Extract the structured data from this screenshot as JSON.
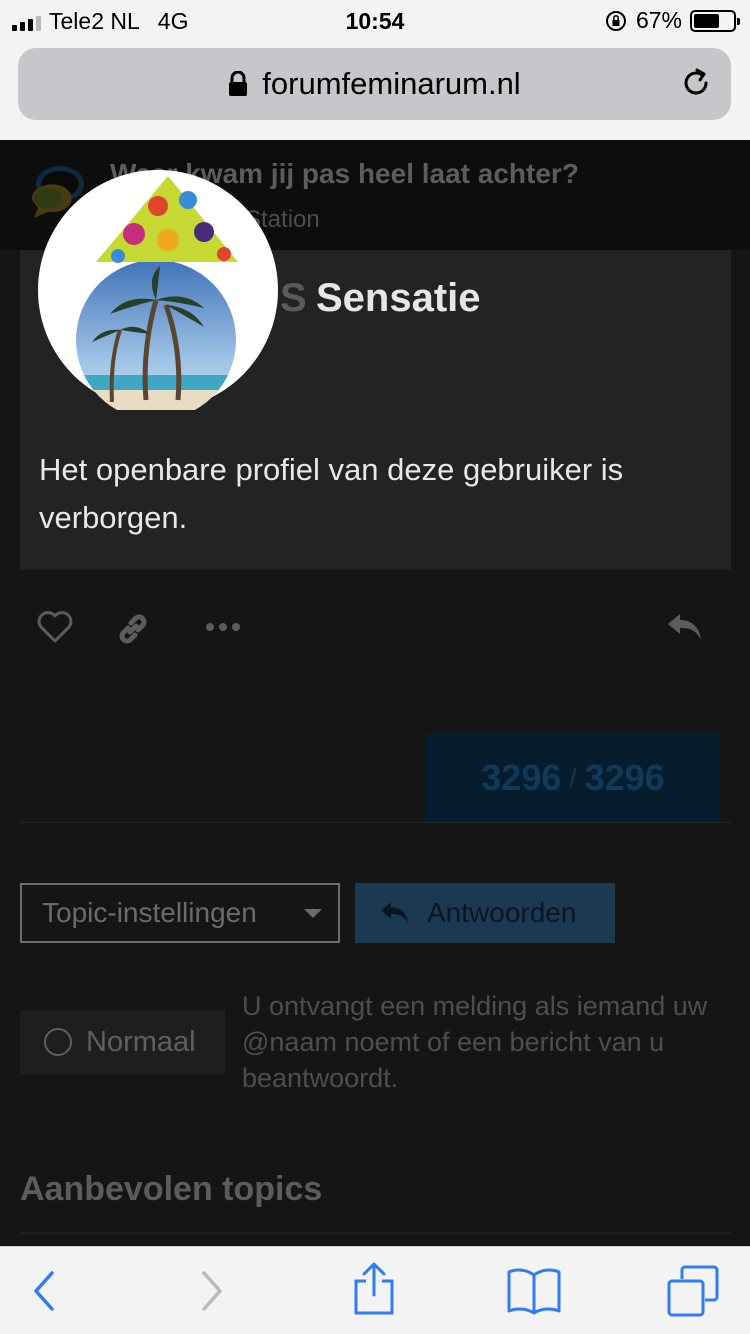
{
  "status_bar": {
    "carrier": "Tele2 NL",
    "network": "4G",
    "time": "10:54",
    "battery_percent": "67%",
    "battery_level": 0.67
  },
  "browser": {
    "url": "forumfeminarum.nl"
  },
  "topic": {
    "title": "Waar kwam jij pas heel laat achter?",
    "category": "Station"
  },
  "user_card": {
    "username": "Sensatie",
    "profile_notice": "Het openbare profiel van deze gebruiker is verborgen."
  },
  "progress": {
    "current": "3296",
    "separator": "/",
    "total": "3296"
  },
  "controls": {
    "topic_settings_label": "Topic-instellingen",
    "reply_label": "Antwoorden",
    "notification_level": "Normaal",
    "notification_description": "U ontvangt een melding als iemand uw @naam noemt of een bericht van u beantwoordt."
  },
  "sections": {
    "recommended_title": "Aanbevolen topics"
  },
  "icons": {
    "like": "heart-icon",
    "link": "link-icon",
    "more": "more-icon",
    "reply": "reply-icon",
    "back": "back-icon",
    "forward": "forward-icon",
    "share": "share-icon",
    "bookmarks": "bookmarks-icon",
    "tabs": "tabs-icon"
  },
  "colors": {
    "accent_blue": "#1b3a52",
    "ios_blue": "#2f7cf6"
  }
}
